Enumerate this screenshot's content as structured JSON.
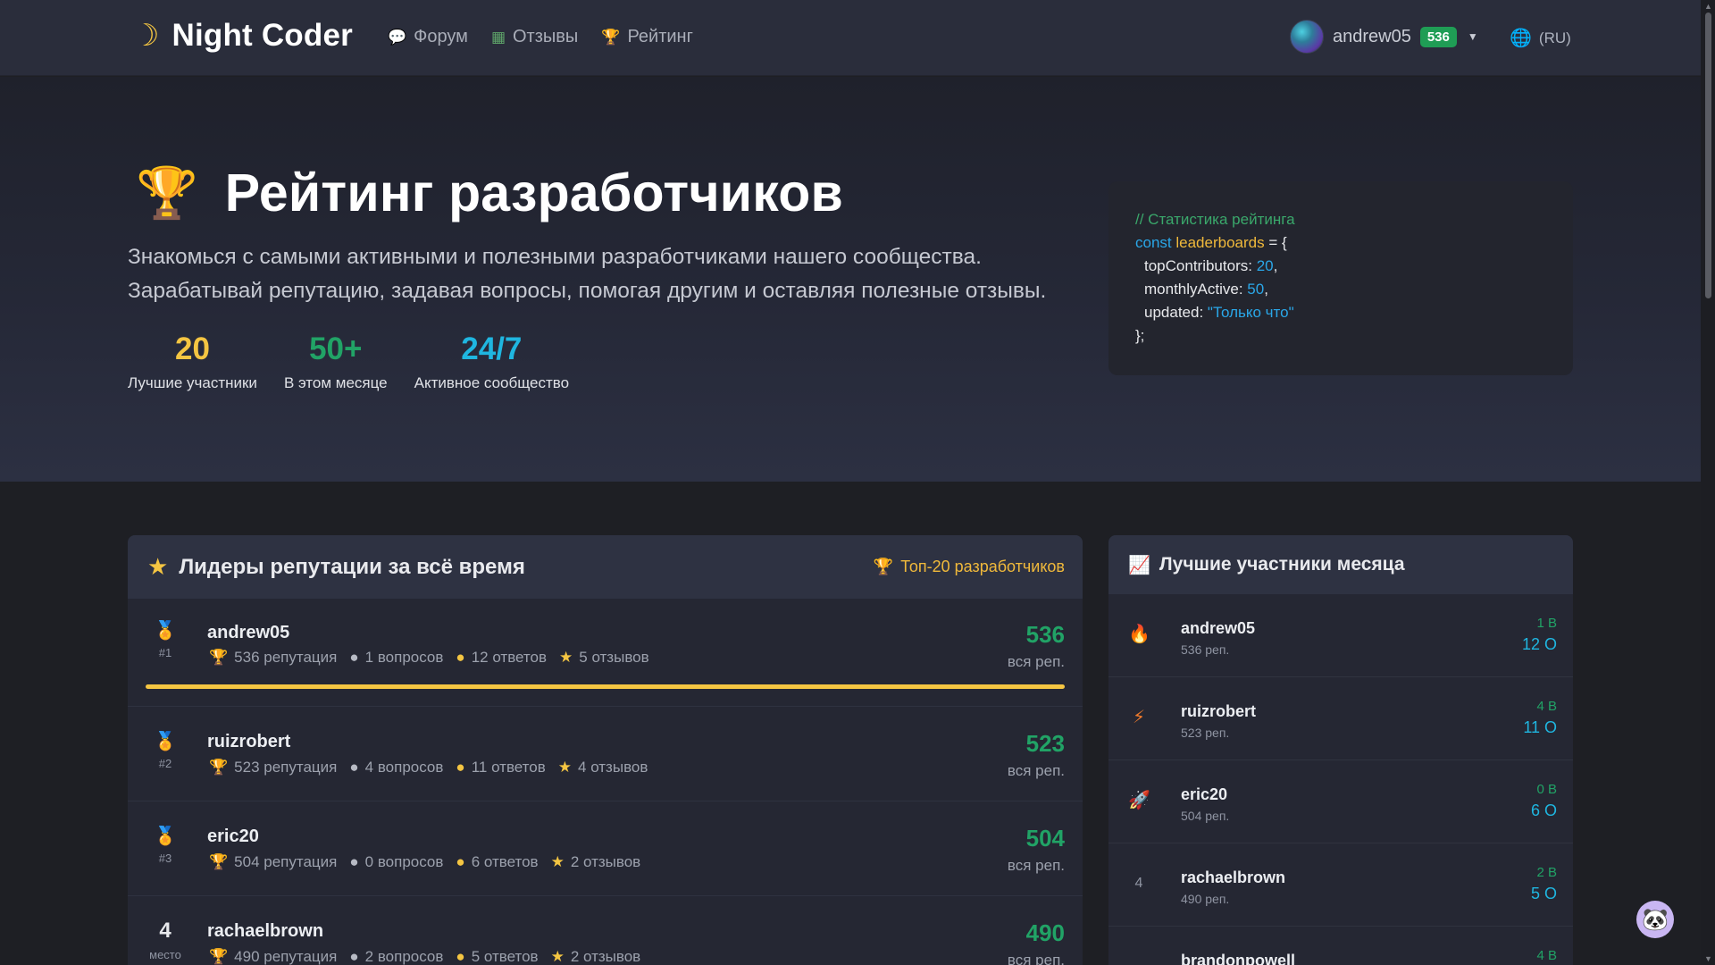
{
  "nav": {
    "brand": "Night Coder",
    "links": [
      {
        "icon": "chat-icon",
        "label": "Форум"
      },
      {
        "icon": "books-icon",
        "label": "Отзывы"
      },
      {
        "icon": "trophy-icon",
        "label": "Рейтинг"
      }
    ],
    "user": {
      "name": "andrew05",
      "rep": "536"
    },
    "lang": "(RU)"
  },
  "hero": {
    "title": "Рейтинг разработчиков",
    "description": "Знакомься с самыми активными и полезными разработчиками нашего сообщества. Зарабатывай репутацию, задавая вопросы, помогая другим и оставляя полезные отзывы.",
    "stats": [
      {
        "value": "20",
        "label": "Лучшие участники"
      },
      {
        "value": "50+",
        "label": "В этом месяце"
      },
      {
        "value": "24/7",
        "label": "Активное сообщество"
      }
    ],
    "code": {
      "comment": "// Статистика рейтинга",
      "kw": "const",
      "var": "leaderboards",
      "eq": " = {",
      "l1k": "topContributors: ",
      "l1v": "20",
      "l2k": "monthlyActive: ",
      "l2v": "50",
      "l3k": "updated: ",
      "l3v": "\"Только что\"",
      "close": "};",
      "comma": ","
    }
  },
  "leaders": {
    "title": "Лидеры репутации за всё время",
    "top_link": "Топ-20 разработчиков",
    "all_label": "вся реп.",
    "place_label": "место",
    "rows": [
      {
        "rank": "#1",
        "medal": "gold",
        "name": "andrew05",
        "rep": "536 репутация",
        "questions": "1 вопросов",
        "answers": "12 ответов",
        "reviews": "5 отзывов",
        "points": "536",
        "progress": 1.0
      },
      {
        "rank": "#2",
        "medal": "silver",
        "name": "ruizrobert",
        "rep": "523 репутация",
        "questions": "4 вопросов",
        "answers": "11 ответов",
        "reviews": "4 отзывов",
        "points": "523"
      },
      {
        "rank": "#3",
        "medal": "bronze",
        "name": "eric20",
        "rep": "504 репутация",
        "questions": "0 вопросов",
        "answers": "6 ответов",
        "reviews": "2 отзывов",
        "points": "504"
      },
      {
        "rank": "4",
        "medal": "none",
        "name": "rachaelbrown",
        "rep": "490 репутация",
        "questions": "2 вопросов",
        "answers": "5 ответов",
        "reviews": "2 отзывов",
        "points": "490"
      }
    ]
  },
  "monthly": {
    "title": "Лучшие участники месяца",
    "rows": [
      {
        "icon": "fire-icon",
        "name": "andrew05",
        "rep": "536 реп.",
        "v": "1 В",
        "o": "12 О"
      },
      {
        "icon": "lightning-icon",
        "name": "ruizrobert",
        "rep": "523 реп.",
        "v": "4 В",
        "o": "11 О"
      },
      {
        "icon": "rocket-icon",
        "name": "eric20",
        "rep": "504 реп.",
        "v": "0 В",
        "o": "6 О"
      },
      {
        "icon": "",
        "num": "4",
        "name": "rachaelbrown",
        "rep": "490 реп.",
        "v": "2 В",
        "o": "5 О"
      },
      {
        "icon": "",
        "num": "",
        "name": "brandonpowell",
        "rep": "",
        "v": "4 В",
        "o": ""
      }
    ]
  },
  "colors": {
    "accent_green": "#21a366",
    "accent_gold": "#f4c542",
    "accent_blue": "#1fb6e0"
  }
}
